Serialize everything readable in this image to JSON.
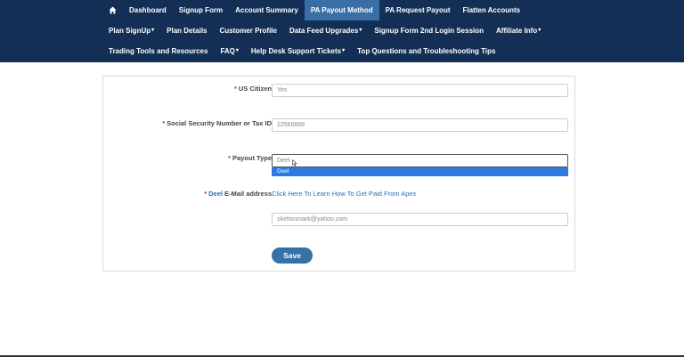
{
  "nav": {
    "row1": [
      {
        "label": "Dashboard"
      },
      {
        "label": "Signup Form"
      },
      {
        "label": "Account Summary"
      },
      {
        "label": "PA Payout Method",
        "active": true
      },
      {
        "label": "PA Request Payout"
      },
      {
        "label": "Flatten Accounts"
      }
    ],
    "row2": [
      {
        "label": "Plan SignUp",
        "dropdown": true
      },
      {
        "label": "Plan Details"
      },
      {
        "label": "Customer Profile"
      },
      {
        "label": "Data Feed Upgrades",
        "dropdown": true
      },
      {
        "label": "Signup Form 2nd Login Session"
      },
      {
        "label": "Affiliate Info",
        "dropdown": true
      }
    ],
    "row3": [
      {
        "label": "Trading Tools and Resources"
      },
      {
        "label": "FAQ",
        "dropdown": true
      },
      {
        "label": "Help Desk Support Tickets",
        "dropdown": true
      },
      {
        "label": "Top Questions and Troubleshooting Tips"
      }
    ],
    "home_icon": "home-icon",
    "bg_color": "#132f55",
    "active_color": "#3a6fa5"
  },
  "form": {
    "us_citizen": {
      "label": "US Citizen",
      "value": "Yes"
    },
    "ssn": {
      "label": "Social Security Number or Tax ID",
      "value": "22566666"
    },
    "payout_type": {
      "label": "Payout Type",
      "value": "Deel",
      "dropdown_option": "Deel"
    },
    "deel_email": {
      "label_prefix": "Deel",
      "label_suffix": " E-Mail address",
      "link": "Click Here To Learn How To Get Paid From Apex",
      "value": "skeltonmark@yahoo.com"
    },
    "required_mark": "*",
    "save_label": "Save"
  }
}
